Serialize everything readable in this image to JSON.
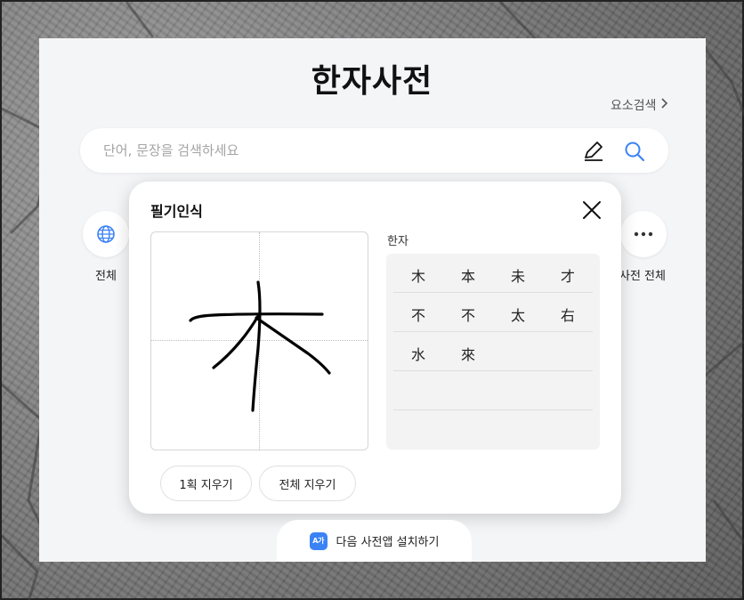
{
  "page": {
    "title": "한자사전",
    "element_search_label": "요소검색"
  },
  "search": {
    "placeholder": "단어, 문장을 검색하세요",
    "value": ""
  },
  "icons": {
    "pen": "pen-icon",
    "search": "search-icon",
    "globe": "globe-icon",
    "more": "more-dots-icon",
    "close": "close-icon",
    "app": "daum-dictionary-app-icon"
  },
  "categories": {
    "all_label": "전체",
    "more_label": "사전 전체"
  },
  "handwriting": {
    "title": "필기인식",
    "result_label": "한자",
    "candidates": [
      [
        "木",
        "本",
        "未",
        "才"
      ],
      [
        "不",
        "不",
        "太",
        "右"
      ],
      [
        "水",
        "來"
      ]
    ],
    "undo_label": "1획 지우기",
    "clear_label": "전체 지우기"
  },
  "install": {
    "icon_text": "A가",
    "label": "다음 사전앱 설치하기"
  },
  "colors": {
    "accent": "#3b82f6",
    "panel": "#f4f5f7"
  }
}
